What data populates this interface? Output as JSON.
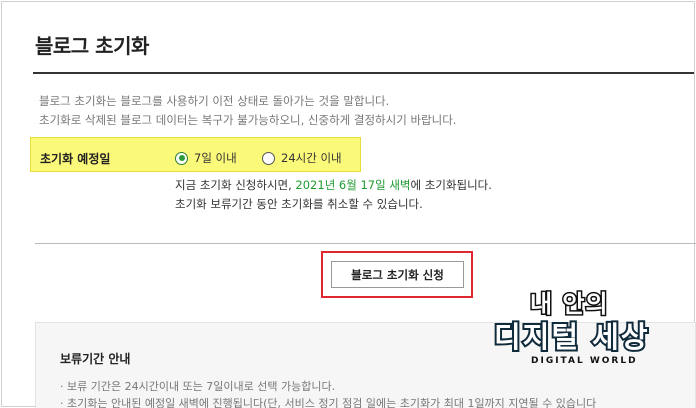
{
  "page": {
    "title": "블로그 초기화",
    "description": [
      "블로그 초기화는 블로그를 사용하기 이전 상태로 돌아가는 것을 말합니다.",
      "초기화로 삭제된 블로그 데이터는 복구가 불가능하오니, 신중하게 결정하시기 바랍니다."
    ]
  },
  "schedule": {
    "label": "초기화 예정일",
    "options": [
      {
        "label": "7일 이내",
        "selected": true
      },
      {
        "label": "24시간 이내",
        "selected": false
      }
    ],
    "info_prefix": "지금 초기화 신청하시면, ",
    "info_date": "2021년 6월 17일 새벽",
    "info_suffix": "에 초기화됩니다.",
    "info_line2": "초기화 보류기간 동안 초기화를 취소할 수 있습니다."
  },
  "action": {
    "button_label": "블로그 초기화 신청"
  },
  "guide": {
    "title": "보류기간 안내",
    "items": [
      "· 보류 기간은 24시간이내 또는 7일이내로 선택 가능합니다.",
      "· 초기화는 안내된 예정일 새벽에 진행됩니다(단, 서비스 정기 점검 일에는 초기화가 최대 1일까지 지연될 수 있습니다"
    ]
  },
  "watermark": {
    "top": "내 안의",
    "main": "디지털 세상",
    "sub": "DIGITAL WORLD"
  },
  "colors": {
    "highlight_yellow": "#fbf97a",
    "highlight_red": "#e0272f",
    "date_green": "#1e9a2f",
    "radio_green": "#2e9b3a"
  }
}
